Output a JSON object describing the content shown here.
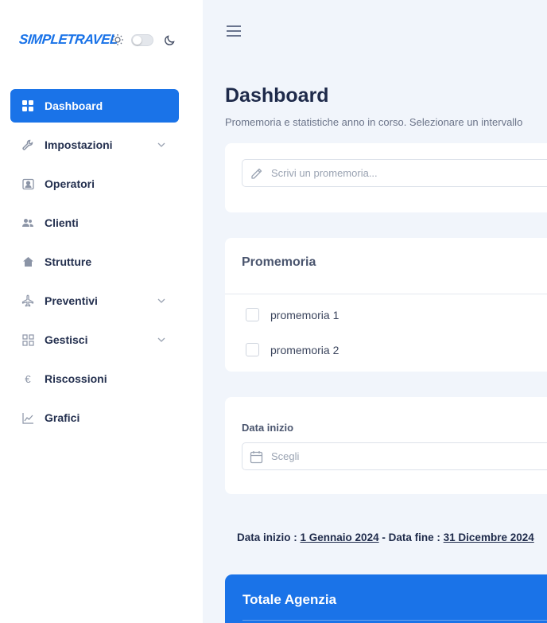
{
  "brand": {
    "logo": "SIMPLETRAVEL",
    "theme_toggle": "off"
  },
  "sidebar": {
    "items": [
      {
        "label": "Dashboard",
        "icon": "dashboard-grid-icon",
        "active": true,
        "has_submenu": false
      },
      {
        "label": "Impostazioni",
        "icon": "wrench-icon",
        "active": false,
        "has_submenu": true
      },
      {
        "label": "Operatori",
        "icon": "user-badge-icon",
        "active": false,
        "has_submenu": false
      },
      {
        "label": "Clienti",
        "icon": "users-icon",
        "active": false,
        "has_submenu": false
      },
      {
        "label": "Strutture",
        "icon": "home-icon",
        "active": false,
        "has_submenu": false
      },
      {
        "label": "Preventivi",
        "icon": "airplane-icon",
        "active": false,
        "has_submenu": true
      },
      {
        "label": "Gestisci",
        "icon": "apps-icon",
        "active": false,
        "has_submenu": true
      },
      {
        "label": "Riscossioni",
        "icon": "euro-icon",
        "active": false,
        "has_submenu": false
      },
      {
        "label": "Grafici",
        "icon": "line-chart-icon",
        "active": false,
        "has_submenu": false
      }
    ]
  },
  "header": {
    "title": "Dashboard",
    "subtitle": "Promemoria e statistiche anno in corso. Selezionare un intervallo"
  },
  "reminder_input": {
    "placeholder": "Scrivi un promemoria..."
  },
  "reminders": {
    "title": "Promemoria",
    "items": [
      {
        "text": "promemoria 1",
        "checked": false
      },
      {
        "text": "promemoria 2",
        "checked": false
      }
    ]
  },
  "date_filter": {
    "label": "Data inizio",
    "placeholder": "Scegli"
  },
  "range": {
    "start_label": "Data inizio :",
    "start_value": "1 Gennaio 2024",
    "separator": "-",
    "end_label": "Data fine :",
    "end_value": "31 Dicembre 2024"
  },
  "total_card": {
    "title": "Totale Agenzia"
  },
  "colors": {
    "accent": "#1a73e8",
    "background": "#f1f5fb",
    "text": "#1e2a4a"
  }
}
